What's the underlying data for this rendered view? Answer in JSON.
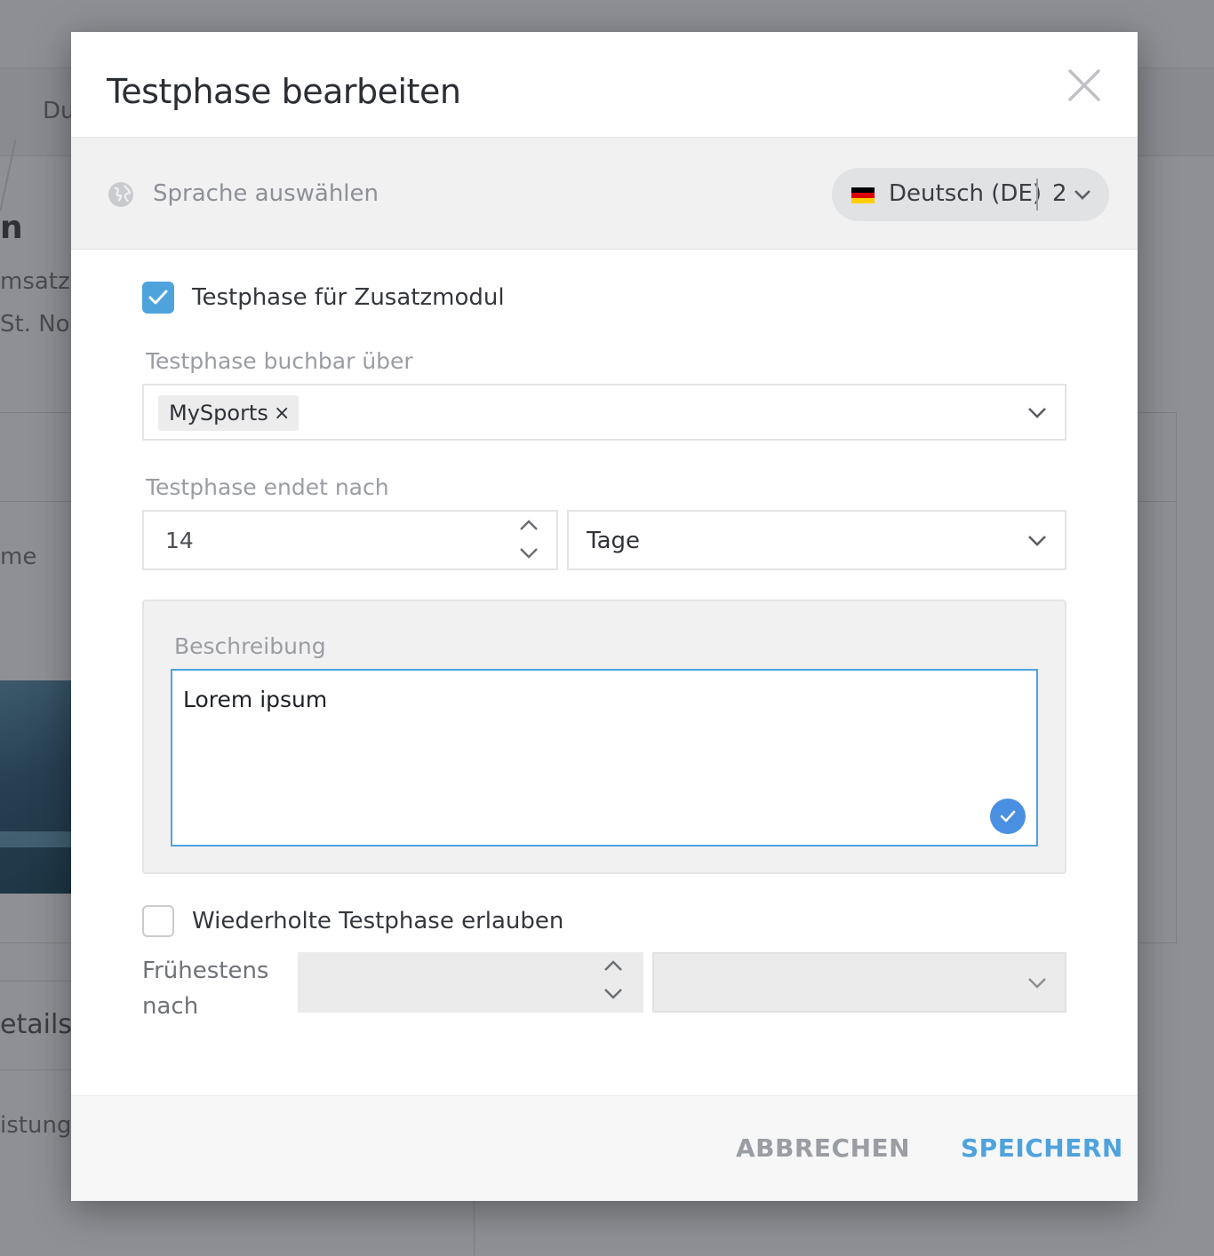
{
  "background": {
    "crumb": "Du",
    "heading_fragment": "n",
    "line1": "msatzst",
    "line2": "St. Norr",
    "col_fragment": "me",
    "section_fragment": "etails",
    "row_fragment": "istungs"
  },
  "modal": {
    "title": "Testphase bearbeiten",
    "close_icon": "close-icon"
  },
  "language": {
    "label": "Sprache auswählen",
    "selected": "Deutsch (DE)",
    "count": "2",
    "flag_colors": [
      "#000000",
      "#dd0000",
      "#ffce00"
    ]
  },
  "form": {
    "addon_trial": {
      "label": "Testphase für Zusatzmodul",
      "checked": true
    },
    "bookable_via": {
      "label": "Testphase buchbar über",
      "tags": [
        "MySports"
      ],
      "tag_remove": "×"
    },
    "ends_after": {
      "label": "Testphase endet nach",
      "value": "14",
      "unit": "Tage"
    },
    "description": {
      "label": "Beschreibung",
      "value": "Lorem ipsum"
    },
    "repeat_trial": {
      "label": "Wiederholte Testphase erlauben",
      "checked": false
    },
    "earliest_after": {
      "label_line1": "Frühestens",
      "label_line2": "nach",
      "value": "",
      "unit": ""
    }
  },
  "footer": {
    "cancel": "ABBRECHEN",
    "save": "SPEICHERN"
  },
  "colors": {
    "accent": "#4ea3dc",
    "check_badge": "#4a90e2",
    "overlay": "#8f9196"
  }
}
